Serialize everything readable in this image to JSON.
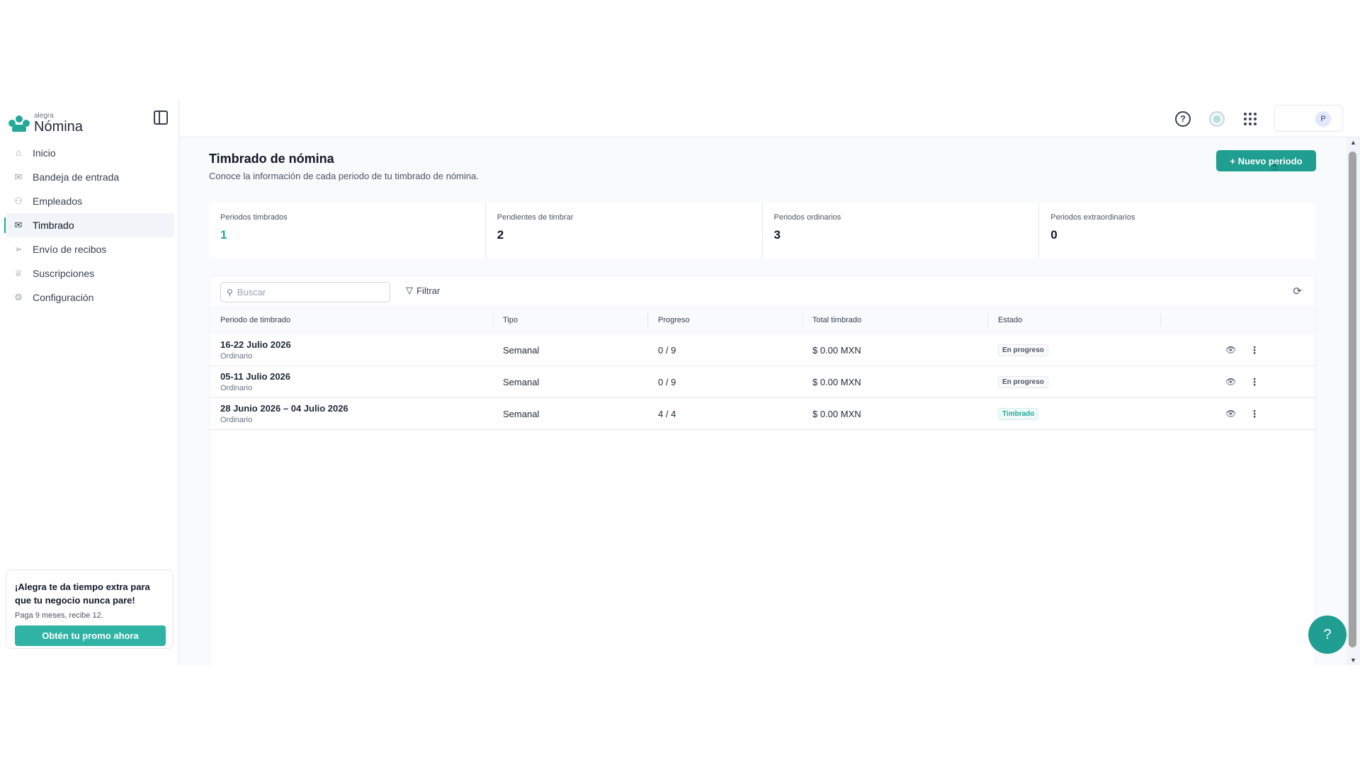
{
  "brand": {
    "small": "alegra",
    "name": "Nómina"
  },
  "sidebar": {
    "items": [
      {
        "label": "Inicio",
        "icon": "home-icon"
      },
      {
        "label": "Bandeja de entrada",
        "icon": "inbox-icon"
      },
      {
        "label": "Empleados",
        "icon": "users-icon"
      },
      {
        "label": "Timbrado",
        "icon": "mail-icon",
        "active": true
      },
      {
        "label": "Envío de recibos",
        "icon": "send-icon"
      },
      {
        "label": "Suscripciones",
        "icon": "crown-icon"
      },
      {
        "label": "Configuración",
        "icon": "gear-icon"
      }
    ]
  },
  "promo": {
    "title": "¡Alegra te da tiempo extra para que tu negocio nunca pare!",
    "subtitle": "Paga 9 meses, recibe 12.",
    "button": "Obtén tu promo ahora"
  },
  "topbar": {
    "avatar": "P"
  },
  "page": {
    "title": "Timbrado de nómina",
    "subtitle": "Conoce la información de cada periodo de tu timbrado de nómina.",
    "new_button": "+ Nuevo periodo"
  },
  "stats": [
    {
      "label": "Periodos timbrados",
      "value": "1"
    },
    {
      "label": "Pendientes de timbrar",
      "value": "2"
    },
    {
      "label": "Periodos ordinarios",
      "value": "3"
    },
    {
      "label": "Periodos extraordinarios",
      "value": "0"
    }
  ],
  "table": {
    "search_placeholder": "Buscar",
    "filter_label": "Filtrar",
    "headers": [
      "Periodo de timbrado",
      "Tipo",
      "Progreso",
      "Total timbrado",
      "Estado"
    ],
    "rows": [
      {
        "period": "16-22 Julio 2026",
        "period_type": "Ordinario",
        "tipo": "Semanal",
        "progreso": "0 / 9",
        "total": "$ 0.00 MXN",
        "estado": "En progreso"
      },
      {
        "period": "05-11 Julio 2026",
        "period_type": "Ordinario",
        "tipo": "Semanal",
        "progreso": "0 / 9",
        "total": "$ 0.00 MXN",
        "estado": "En progreso"
      },
      {
        "period": "28 Junio 2026 – 04 Julio 2026",
        "period_type": "Ordinario",
        "tipo": "Semanal",
        "progreso": "4 / 4",
        "total": "$ 0.00 MXN",
        "estado": "Timbrado"
      }
    ]
  },
  "colors": {
    "accent": "#23a89a",
    "button": "#1f9e91"
  }
}
